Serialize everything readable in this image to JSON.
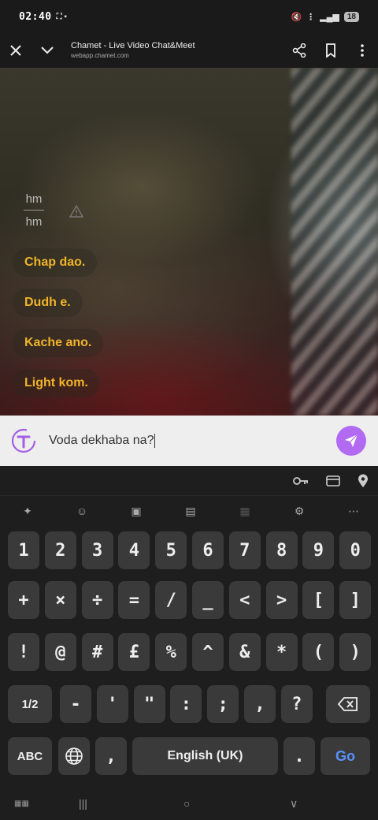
{
  "status_bar": {
    "time": "02:40",
    "battery": "18"
  },
  "browser": {
    "title": "Chamet - Live Video Chat&Meet",
    "url": "webapp.chamet.com"
  },
  "chat": {
    "fraction_top": "hm",
    "fraction_bottom": "hm",
    "messages": [
      "Chap dao.",
      "Dudh e.",
      "Kache ano.",
      "Light kom."
    ]
  },
  "input": {
    "value": "Voda dekhaba na?"
  },
  "keyboard": {
    "row1": [
      "1",
      "2",
      "3",
      "4",
      "5",
      "6",
      "7",
      "8",
      "9",
      "0"
    ],
    "row2": [
      "+",
      "×",
      "÷",
      "=",
      "/",
      "_",
      "<",
      ">",
      "[",
      "]"
    ],
    "row3": [
      "!",
      "@",
      "#",
      "£",
      "%",
      "^",
      "&",
      "*",
      "(",
      ")"
    ],
    "row4": [
      "1/2",
      "-",
      "'",
      "\"",
      ":",
      ";",
      ",",
      "?"
    ],
    "abc_label": "ABC",
    "comma": ",",
    "space_label": "English (UK)",
    "period": ".",
    "go_label": "Go"
  },
  "colors": {
    "accent": "#b26af2",
    "chat_text": "#f0b429",
    "go": "#5b8ff9"
  }
}
